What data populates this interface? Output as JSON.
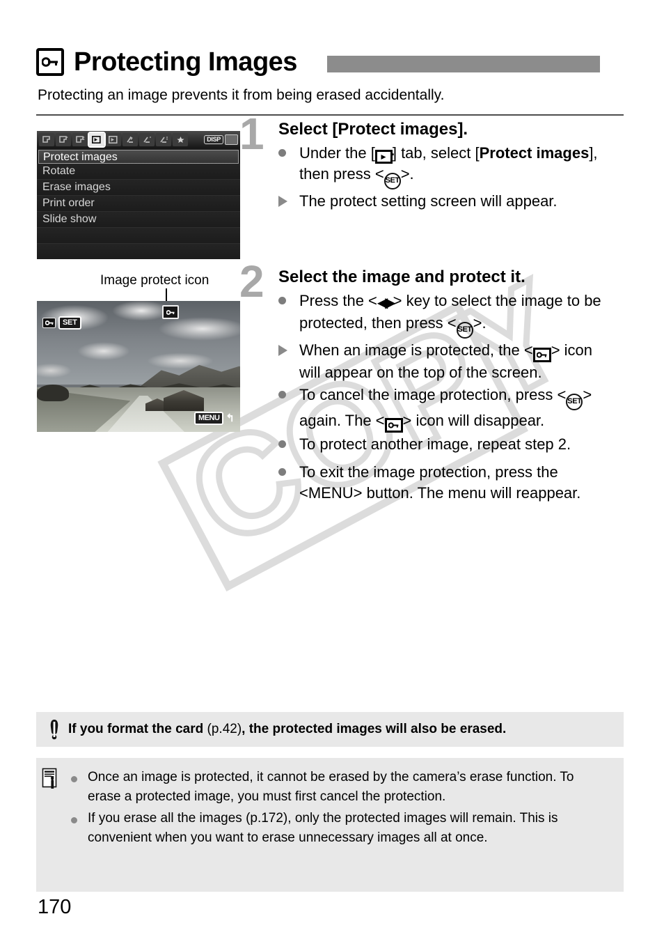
{
  "header": {
    "icon": "protect-key-icon",
    "title": "Protecting Images",
    "subtitle": "Protecting an image prevents it from being erased accidentally."
  },
  "watermark": {
    "text": "COPY",
    "color": "#dcdcdc"
  },
  "camera_menu": {
    "selected_tab_index": 3,
    "tabs": [
      "shoot-tab-1",
      "shoot-tab-2",
      "shoot-tab-3",
      "playback-tab-1",
      "playback-tab-2",
      "setup-tab-1",
      "setup-tab-2",
      "setup-tab-3",
      "my-menu-tab"
    ],
    "disp_label": "DISP",
    "items": [
      {
        "label": "Protect images",
        "selected": true
      },
      {
        "label": "Rotate",
        "selected": false
      },
      {
        "label": "Erase images",
        "selected": false
      },
      {
        "label": "Print order",
        "selected": false
      },
      {
        "label": "Slide show",
        "selected": false
      }
    ]
  },
  "photo_screen": {
    "caption": "Image protect icon",
    "overlay_key_icon": "protect-key-icon",
    "overlay_set_label": "SET",
    "overlay_menu_label": "MENU",
    "overlay_return_glyph": "↰"
  },
  "steps": [
    {
      "number": "1",
      "heading": "Select [Protect images].",
      "bullets": [
        {
          "mark": "dot",
          "segments": [
            {
              "t": "Under the ["
            },
            {
              "g": "playback-tab-icon"
            },
            {
              "t": "] tab, select ["
            },
            {
              "t": "Protect images",
              "bold": true
            },
            {
              "t": "], then press <"
            },
            {
              "g": "set-icon"
            },
            {
              "t": ">."
            }
          ]
        },
        {
          "mark": "triangle",
          "segments": [
            {
              "t": "The protect setting screen will appear."
            }
          ]
        }
      ]
    },
    {
      "number": "2",
      "heading": "Select the image and protect it.",
      "bullets": [
        {
          "mark": "dot",
          "segments": [
            {
              "t": "Press the <"
            },
            {
              "g": "left-right-key-icon"
            },
            {
              "t": "> key to select the image to be protected, then press <"
            },
            {
              "g": "set-icon"
            },
            {
              "t": ">."
            }
          ]
        },
        {
          "mark": "triangle",
          "segments": [
            {
              "t": "When an image is protected, the <"
            },
            {
              "g": "protect-key-icon"
            },
            {
              "t": "> icon will appear on the top of the screen."
            }
          ]
        },
        {
          "mark": "dot",
          "segments": [
            {
              "t": "To cancel the image protection, press <"
            },
            {
              "g": "set-icon"
            },
            {
              "t": "> again. The <"
            },
            {
              "g": "protect-key-icon"
            },
            {
              "t": "> icon will disappear."
            }
          ]
        },
        {
          "mark": "dot",
          "segments": [
            {
              "t": "To protect another image, repeat step 2."
            }
          ]
        },
        {
          "mark": "dot",
          "segments": [
            {
              "t": "To exit the image protection, press the <"
            },
            {
              "t": "MENU",
              "menu": true
            },
            {
              "t": "> button. The menu will reappear."
            }
          ]
        }
      ]
    }
  ],
  "warning_box": {
    "icon": "exclamation-icon",
    "text_bold_1": "If you format the card ",
    "text_regular": "(p.42)",
    "text_bold_2": ", the protected images will also be erased."
  },
  "note_box": {
    "icon": "note-pencil-icon",
    "items": [
      "Once an image is protected, it cannot be erased by the camera’s erase function. To erase a protected image, you must first cancel the protection.",
      "If you erase all the images (p.172), only the protected images will remain. This is convenient when you want to erase unnecessary images all at once."
    ]
  },
  "page_number": "170"
}
